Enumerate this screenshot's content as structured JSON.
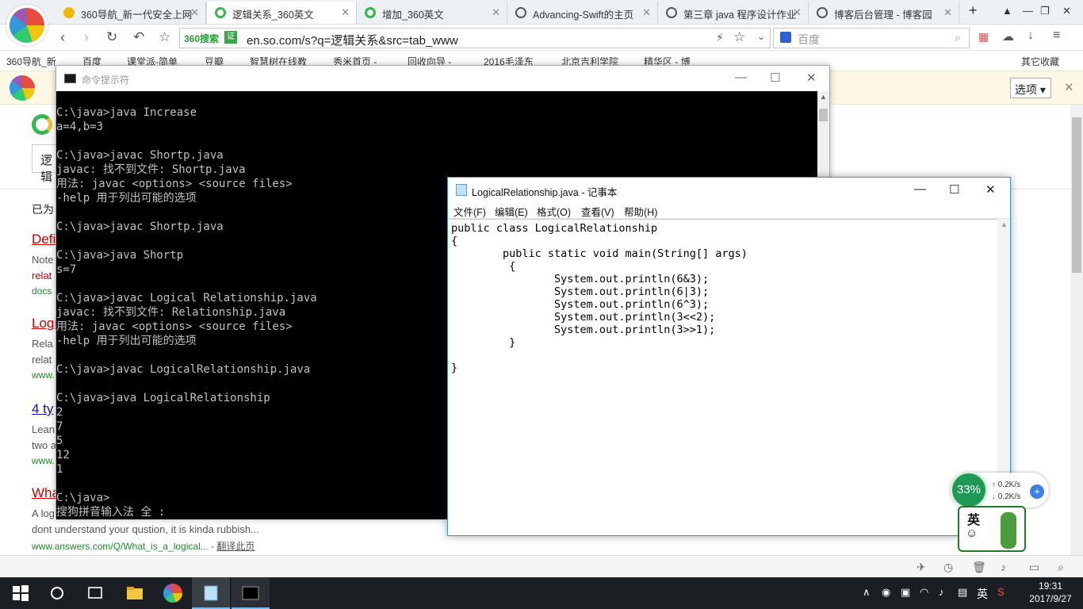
{
  "browser": {
    "tabs": [
      {
        "label": "360导航_新一代安全上网",
        "icon_color": "#f2b705"
      },
      {
        "label": "逻辑关系_360英文",
        "icon_color": "#37b64b"
      },
      {
        "label": "增加_360英文",
        "icon_color": "#37b64b"
      },
      {
        "label": "Advancing-Swift的主页",
        "icon_color": "#555555"
      },
      {
        "label": "第三章 java 程序设计作业",
        "icon_color": "#555555"
      },
      {
        "label": "博客后台管理 - 博客园",
        "icon_color": "#555555"
      }
    ],
    "address": {
      "badge": "360搜索",
      "lock": "证",
      "url": "en.so.com/s?q=逻辑关系&src=tab_www"
    },
    "search": {
      "placeholder": "百度"
    },
    "bookmarks": [
      "360导航_新",
      "百度",
      "课堂派-简单",
      "豆瓣",
      "智慧树在线教",
      "秀米首页 -",
      "回收向导 -",
      "2016毛泽东",
      "北京吉利学院",
      "精华区 - 博"
    ],
    "other_bookmarks": "其它收藏",
    "notice": {
      "options_label": "选项"
    }
  },
  "page": {
    "search_value": "逻辑",
    "results_prefix": "已为",
    "results": [
      {
        "title": "Defi",
        "snippet1": "Note",
        "snippet2": "relat",
        "url": "docs"
      },
      {
        "title": "Logi",
        "snippet1": "Rela",
        "snippet2": "relat",
        "url": "www."
      },
      {
        "title": "4 ty",
        "snippet1": "Lean",
        "snippet2": "two a",
        "url": "www."
      },
      {
        "title": "Wha",
        "snippet1": "A log",
        "snippet2": "dont understand your qustion, it is kinda rubbish...",
        "url": "www.answers.com/Q/What_is_a_logical...",
        "translate": "翻译此页"
      }
    ]
  },
  "cmd": {
    "title": "命令提示符",
    "lines": [
      "C:\\java>java Increase",
      "a=4,b=3",
      "",
      "C:\\java>javac Shortp.java",
      "javac: 找不到文件: Shortp.java",
      "用法: javac <options> <source files>",
      "-help 用于列出可能的选项",
      "",
      "C:\\java>javac Shortp.java",
      "",
      "C:\\java>java Shortp",
      "s=7",
      "",
      "C:\\java>javac Logical Relationship.java",
      "javac: 找不到文件: Relationship.java",
      "用法: javac <options> <source files>",
      "-help 用于列出可能的选项",
      "",
      "C:\\java>javac LogicalRelationship.java",
      "",
      "C:\\java>java LogicalRelationship",
      "2",
      "7",
      "5",
      "12",
      "1",
      "",
      "C:\\java>",
      "搜狗拼音输入法 全 :"
    ]
  },
  "notepad": {
    "title": "LogicalRelationship.java - 记事本",
    "menu": [
      "文件(F)",
      "编辑(E)",
      "格式(O)",
      "查看(V)",
      "帮助(H)"
    ],
    "content": "public class LogicalRelationship\n{\n        public static void main(String[] args)\n         {\n                System.out.println(6&3);\n                System.out.println(6|3);\n                System.out.println(6^3);\n                System.out.println(3<<2);\n                System.out.println(3>>1);\n         }\n\n}"
  },
  "widgets": {
    "speed": {
      "percent": "33%",
      "up": "0.2K/s",
      "down": "0.2K/s"
    },
    "ime_label": "英"
  },
  "taskbar": {
    "tray_lang": "英",
    "time": "19:31",
    "date": "2017/9/27"
  }
}
